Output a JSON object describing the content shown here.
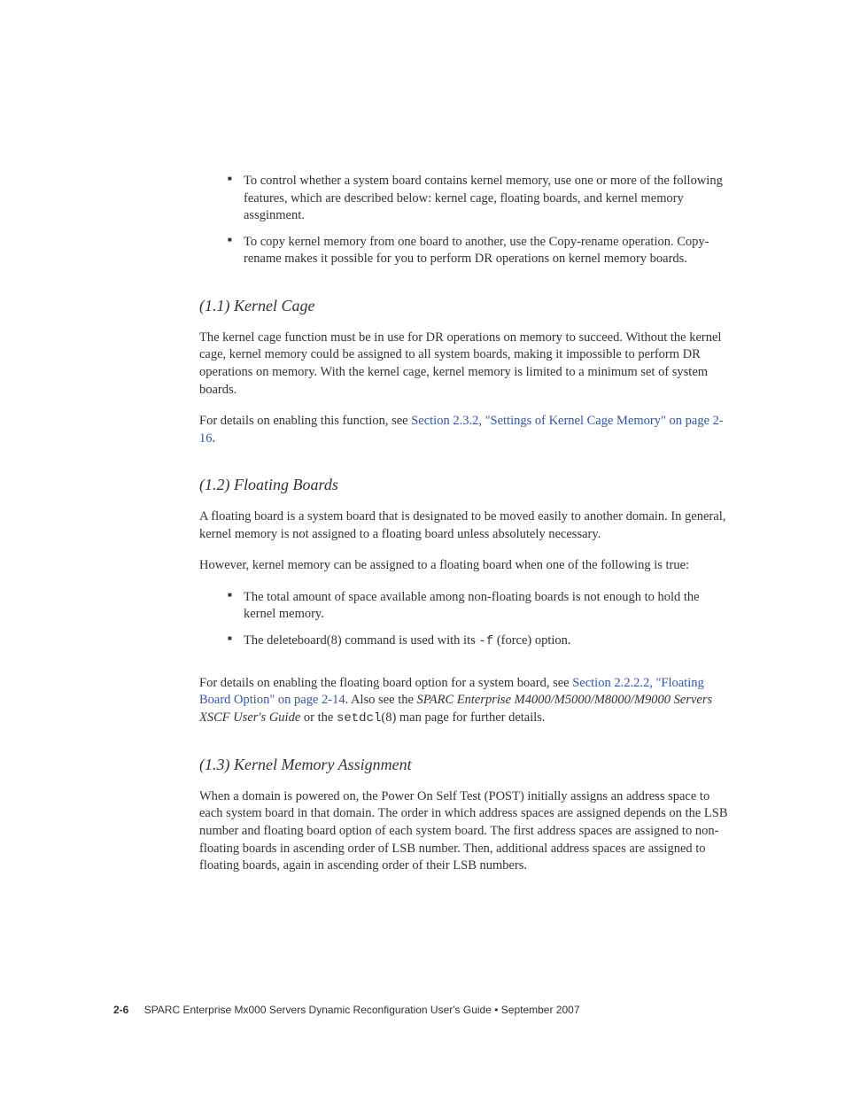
{
  "bullets_top": [
    "To control whether a system board contains kernel memory, use one or more of the following features, which are described below: kernel cage, floating boards, and kernel memory assginment.",
    "To copy kernel memory from one board to another, use the Copy-rename operation. Copy-rename makes it possible for you to perform DR operations on kernel memory boards."
  ],
  "section_1_1": {
    "heading": "(1.1) Kernel Cage",
    "para1": "The kernel cage function must be in use for DR operations on memory to succeed. Without the kernel cage, kernel memory could be assigned to all system boards, making it impossible to perform DR operations on memory. With the kernel cage, kernel memory is limited to a minimum set of system boards.",
    "para2_pre": "For details on enabling this function, see ",
    "para2_link": "Section 2.3.2, \"Settings of Kernel Cage Memory\" on page 2-16",
    "para2_post": "."
  },
  "section_1_2": {
    "heading": "(1.2) Floating Boards",
    "para1": "A floating board is a system board that is designated to be moved easily to another domain. In general, kernel memory is not assigned to a floating board unless absolutely necessary.",
    "para2": "However, kernel memory can be assigned to a floating board when one of the following is true:",
    "bullets": [
      "The total amount of space available among non-floating boards is not enough to hold the kernel memory."
    ],
    "bullet2_pre": "The deleteboard(8) command is used with its ",
    "bullet2_code": "-f",
    "bullet2_post": " (force) option.",
    "para3_pre": "For details on enabling the floating board option for a system board, see ",
    "para3_link": "Section 2.2.2.2, \"Floating Board Option\" on page 2-14",
    "para3_mid": ". Also see the ",
    "para3_italic": "SPARC Enterprise M4000/M5000/M8000/M9000 Servers XSCF User's Guide",
    "para3_mid2": " or the ",
    "para3_code": "setdcl",
    "para3_post": "(8) man page for further details."
  },
  "section_1_3": {
    "heading": "(1.3) Kernel Memory Assignment",
    "para1": "When a domain is powered on, the Power On Self Test (POST) initially assigns an address space to each system board in that domain. The order in which address spaces are assigned depends on the LSB number and floating board option of each system board. The first address spaces are assigned to non-floating boards in ascending order of LSB number. Then, additional address spaces are assigned to floating boards, again in ascending order of their LSB numbers."
  },
  "footer": {
    "page_num": "2-6",
    "doc_title": "SPARC Enterprise Mx000 Servers Dynamic Reconfiguration User's Guide  •  September 2007"
  }
}
